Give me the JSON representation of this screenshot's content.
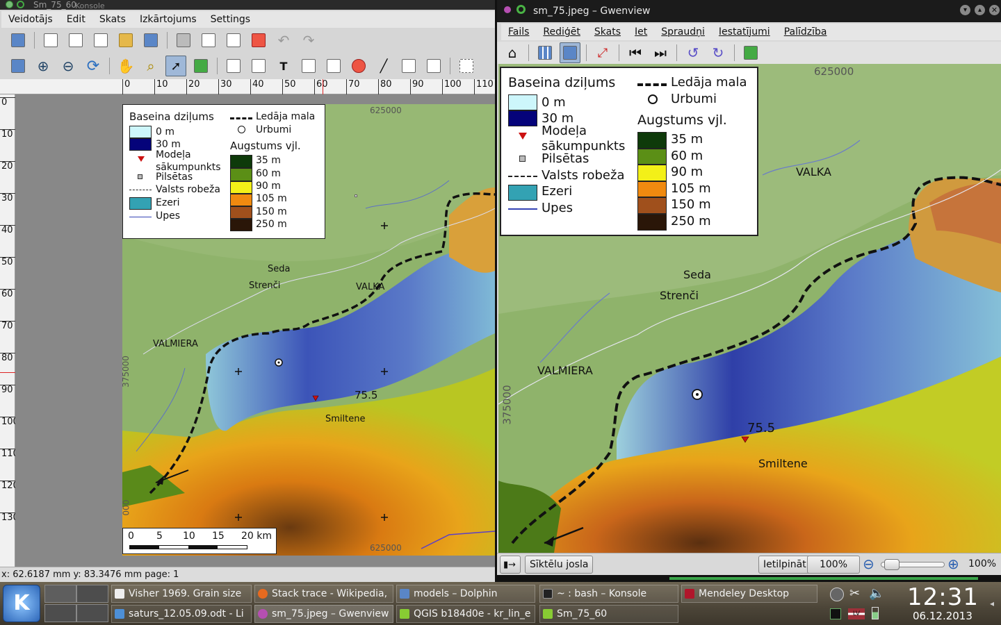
{
  "qgis": {
    "title": "Sm_75_60",
    "title_behind": "Konsole",
    "menu": [
      "Veidotājs",
      "Edit",
      "Skats",
      "Izkārtojums",
      "Settings"
    ],
    "ruler_h": [
      "0",
      "10",
      "20",
      "30",
      "40",
      "50",
      "60",
      "70",
      "80",
      "90",
      "100",
      "110"
    ],
    "ruler_v": [
      "0",
      "10",
      "20",
      "30",
      "40",
      "50",
      "60",
      "70",
      "80",
      "90",
      "100",
      "110",
      "120",
      "130"
    ],
    "status": "x: 62.6187 mm y: 83.3476 mm page: 1",
    "scalebar": {
      "labels": [
        "0",
        "5",
        "10",
        "15",
        "20 km"
      ]
    }
  },
  "legend": {
    "basin_title": "Baseina dziļums",
    "depth_0": "0 m",
    "depth_30": "30 m",
    "model_start_1": "Modeļa",
    "model_start_2": "sākumpunkts",
    "cities": "Pilsētas",
    "border": "Valsts robeža",
    "lakes": "Ezeri",
    "rivers": "Upes",
    "ice_margin": "Ledāja mala",
    "wells": "Urbumi",
    "elev_title": "Augstums vjl.",
    "elev": [
      "35 m",
      "60 m",
      "90 m",
      "105 m",
      "150 m",
      "250 m"
    ],
    "elev_colors": [
      "#0e3a0a",
      "#5b8f16",
      "#f3f018",
      "#f08a10",
      "#a0501c",
      "#2a1608"
    ]
  },
  "map": {
    "places": [
      "VALKA",
      "Seda",
      "Strenči",
      "VALMIERA",
      "Smiltene"
    ],
    "model_value": "75.5",
    "grid_top": "625000",
    "grid_bottom": "625000",
    "grid_left_1": "375000",
    "grid_left_2": "000"
  },
  "gwen": {
    "title": "sm_75.jpeg – Gwenview",
    "menu": [
      "Fails",
      "Rediģēt",
      "Skats",
      "Iet",
      "Spraudņi",
      "Iestatījumi",
      "Palīdzība"
    ],
    "sidebar_btn": "Sīktēlu josla",
    "fit_btn": "Ietilpināt",
    "zoom_btn": "100%",
    "zoom_value": "100%",
    "zoom_level": 0.05,
    "grid_left": "375000",
    "grid_top": "625000"
  },
  "taskbar": {
    "row1": [
      "Visher 1969. Grain size",
      "Stack trace - Wikipedia,",
      "models – Dolphin",
      "~ : bash – Konsole",
      "Mendeley Desktop"
    ],
    "row2": [
      "saturs_12.05.09.odt - Li",
      "sm_75.jpeg – Gwenview",
      "QGIS b184d0e - kr_lin_e",
      "Sm_75_60"
    ],
    "clock": "12:31",
    "date": "06.12.2013",
    "keyboard_layout": "LV"
  }
}
